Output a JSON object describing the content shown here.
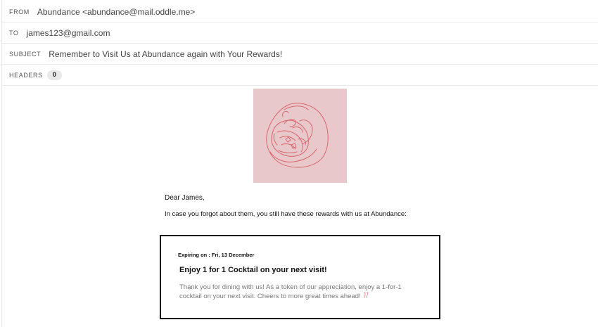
{
  "email": {
    "from": {
      "label": "FROM",
      "value": "Abundance <abundance@mail.oddle.me>"
    },
    "to": {
      "label": "TO",
      "value": "james123@gmail.com"
    },
    "subject": {
      "label": "SUBJECT",
      "value": "Remember to Visit Us at Abundance again with Your Rewards!"
    },
    "headers": {
      "label": "HEADERS",
      "count": "0"
    }
  },
  "body": {
    "hero_image": {
      "icon": "food-illustration",
      "background": "#e9c8cb",
      "stroke": "#d9666e"
    },
    "greeting": "Dear James,",
    "intro": "In case you forgot about them, you still have these rewards with us at Abundance:",
    "reward": {
      "expiry_label": "Expiring on : ",
      "expiry_date": "Fri, 13 December",
      "title": "Enjoy 1 for 1 Cocktail on your next visit!",
      "description": "Thank you for dining with us! As a token of our appreciation, enjoy a 1-for-1 cocktail on your next visit. Cheers to more great times ahead!",
      "emoji_icon": "clinking-glasses-icon"
    }
  }
}
